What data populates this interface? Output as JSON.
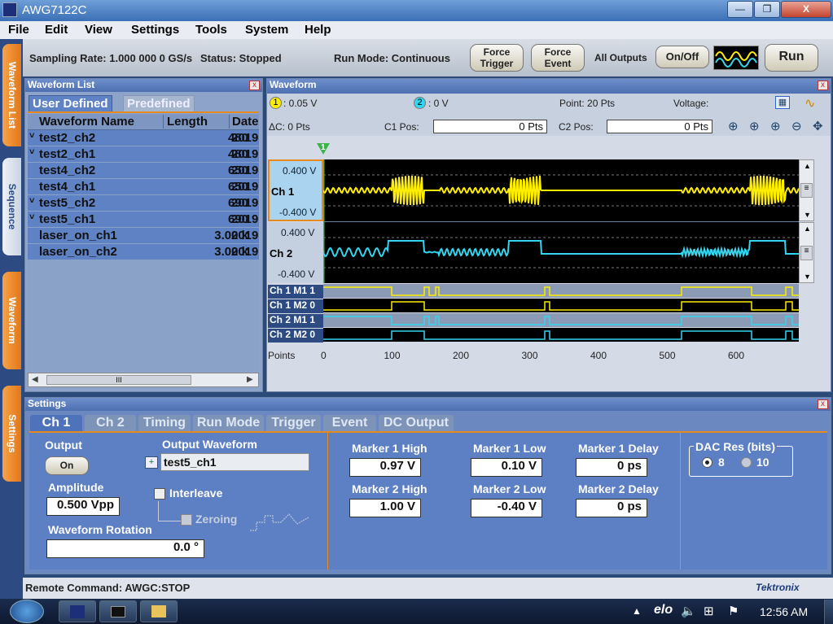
{
  "window": {
    "title": "AWG7122C",
    "min": "—",
    "max": "❐",
    "close": "X"
  },
  "menu": [
    "File",
    "Edit",
    "View",
    "Settings",
    "Tools",
    "System",
    "Help"
  ],
  "side_tabs": [
    "Waveform List",
    "Sequence",
    "Waveform",
    "Settings"
  ],
  "toolbar": {
    "sampling_rate": "Sampling Rate: 1.000 000 0 GS/s",
    "status": "Status: Stopped",
    "run_mode": "Run Mode: Continuous",
    "force_trigger": [
      "Force",
      "Trigger"
    ],
    "force_event": [
      "Force",
      "Event"
    ],
    "all_outputs": "All Outputs",
    "on_off": "On/Off",
    "run": "Run"
  },
  "waveform_list": {
    "title": "Waveform List",
    "tabs": [
      "User Defined",
      "Predefined"
    ],
    "columns": [
      "Waveform Name",
      "Length",
      "Date"
    ],
    "rows": [
      {
        "name": "test2_ch2",
        "length": "480",
        "date": "2019",
        "collapsed": "˅"
      },
      {
        "name": "test2_ch1",
        "length": "480",
        "date": "2019",
        "collapsed": "˅"
      },
      {
        "name": "test4_ch2",
        "length": "650",
        "date": "2019",
        "collapsed": ""
      },
      {
        "name": "test4_ch1",
        "length": "650",
        "date": "2019",
        "collapsed": ""
      },
      {
        "name": "test5_ch2",
        "length": "690",
        "date": "2019",
        "collapsed": "˅"
      },
      {
        "name": "test5_ch1",
        "length": "690",
        "date": "2019",
        "collapsed": "˅"
      },
      {
        "name": "laser_on_ch1",
        "length": "3.00 k",
        "date": "2019",
        "collapsed": ""
      },
      {
        "name": "laser_on_ch2",
        "length": "3.00 k",
        "date": "2019",
        "collapsed": ""
      }
    ],
    "scroll_thumb": "III"
  },
  "waveform": {
    "title": "Waveform",
    "cursor1": "1",
    "cursor1_val": ": 0.05 V",
    "cursor2": "2",
    "cursor2_val": ": 0 V",
    "point": "Point: 20 Pts",
    "voltage": "Voltage:",
    "delta_c": "ΔC: 0 Pts",
    "c1pos_label": "C1 Pos:",
    "c1pos_value": "0 Pts",
    "c2pos_label": "C2 Pos:",
    "c2pos_value": "0 Pts",
    "marker_flag": "1",
    "ch1": {
      "label": "Ch 1",
      "top": "0.400 V",
      "bottom": "-0.400 V",
      "color": "#ffee00"
    },
    "ch2": {
      "label": "Ch 2",
      "top": "0.400 V",
      "bottom": "-0.400 V",
      "color": "#33d6ee"
    },
    "markers": [
      "Ch 1 M1 1",
      "Ch 1 M2 0",
      "Ch 2 M1 1",
      "Ch 2 M2 0"
    ],
    "points_label": "Points",
    "x_ticks": [
      "0",
      "100",
      "200",
      "300",
      "400",
      "500",
      "600"
    ]
  },
  "settings": {
    "title": "Settings",
    "tabs": [
      "Ch 1",
      "Ch 2",
      "Timing",
      "Run Mode",
      "Trigger",
      "Event",
      "DC Output"
    ],
    "output_label": "Output",
    "output_btn": "On",
    "output_waveform_label": "Output Waveform",
    "output_waveform": "test5_ch1",
    "amplitude_label": "Amplitude",
    "amplitude": "0.500 Vpp",
    "interleave": "Interleave",
    "zeroing": "Zeroing",
    "rotation_label": "Waveform Rotation",
    "rotation": "0.0 °",
    "marker1_high_label": "Marker 1 High",
    "marker1_high": "0.97 V",
    "marker1_low_label": "Marker 1 Low",
    "marker1_low": "0.10 V",
    "marker1_delay_label": "Marker 1 Delay",
    "marker1_delay": "0 ps",
    "marker2_high_label": "Marker 2 High",
    "marker2_high": "1.00 V",
    "marker2_low_label": "Marker 2 Low",
    "marker2_low": "-0.40 V",
    "marker2_delay_label": "Marker 2 Delay",
    "marker2_delay": "0 ps",
    "dac_label": "DAC Res (bits)",
    "dac_opt1": "8",
    "dac_opt2": "10"
  },
  "status": {
    "remote": "Remote Command: AWGC:STOP",
    "brand": "Tektronix"
  },
  "taskbar": {
    "clock": "12:56 AM",
    "elo": "elo"
  }
}
